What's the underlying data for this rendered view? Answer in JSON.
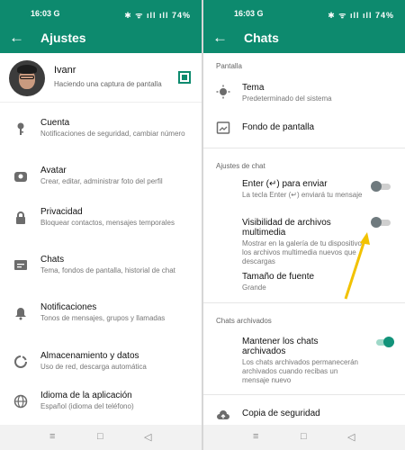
{
  "status_bar": {
    "time": "16:03",
    "carrier": "G",
    "battery": "74%"
  },
  "left": {
    "title": "Ajustes",
    "profile": {
      "name": "Ivanr",
      "status": "Haciendo una captura de pantalla"
    },
    "items": [
      {
        "icon": "key-icon",
        "label": "Cuenta",
        "sub": "Notificaciones de seguridad, cambiar número"
      },
      {
        "icon": "avatar-icon",
        "label": "Avatar",
        "sub": "Crear, editar, administrar foto del perfil"
      },
      {
        "icon": "lock-icon",
        "label": "Privacidad",
        "sub": "Bloquear contactos, mensajes temporales"
      },
      {
        "icon": "chat-icon",
        "label": "Chats",
        "sub": "Tema, fondos de pantalla, historial de chat"
      },
      {
        "icon": "bell-icon",
        "label": "Notificaciones",
        "sub": "Tonos de mensajes, grupos y llamadas"
      },
      {
        "icon": "storage-icon",
        "label": "Almacenamiento y datos",
        "sub": "Uso de red, descarga automática"
      },
      {
        "icon": "globe-icon",
        "label": "Idioma de la aplicación",
        "sub": "Español (idioma del teléfono)"
      }
    ]
  },
  "right": {
    "title": "Chats",
    "sections": {
      "display": "Pantalla",
      "chat_settings": "Ajustes de chat",
      "archived": "Chats archivados"
    },
    "theme": {
      "label": "Tema",
      "sub": "Predeterminado del sistema"
    },
    "wallpaper": {
      "label": "Fondo de pantalla"
    },
    "enter_send": {
      "label": "Enter (↵) para enviar",
      "sub": "La tecla Enter (↵) enviará tu mensaje",
      "on": false
    },
    "media_visibility": {
      "label": "Visibilidad de archivos multimedia",
      "sub": "Mostrar en la galería de tu dispositivo los archivos multimedia nuevos que descargas",
      "on": false
    },
    "font_size": {
      "label": "Tamaño de fuente",
      "sub": "Grande"
    },
    "keep_archived": {
      "label": "Mantener los chats archivados",
      "sub": "Los chats archivados permanecerán archivados cuando recibas un mensaje nuevo",
      "on": true
    },
    "backup": {
      "label": "Copia de seguridad"
    }
  },
  "colors": {
    "brand": "#0d8a6e",
    "arrow": "#f2c200"
  }
}
